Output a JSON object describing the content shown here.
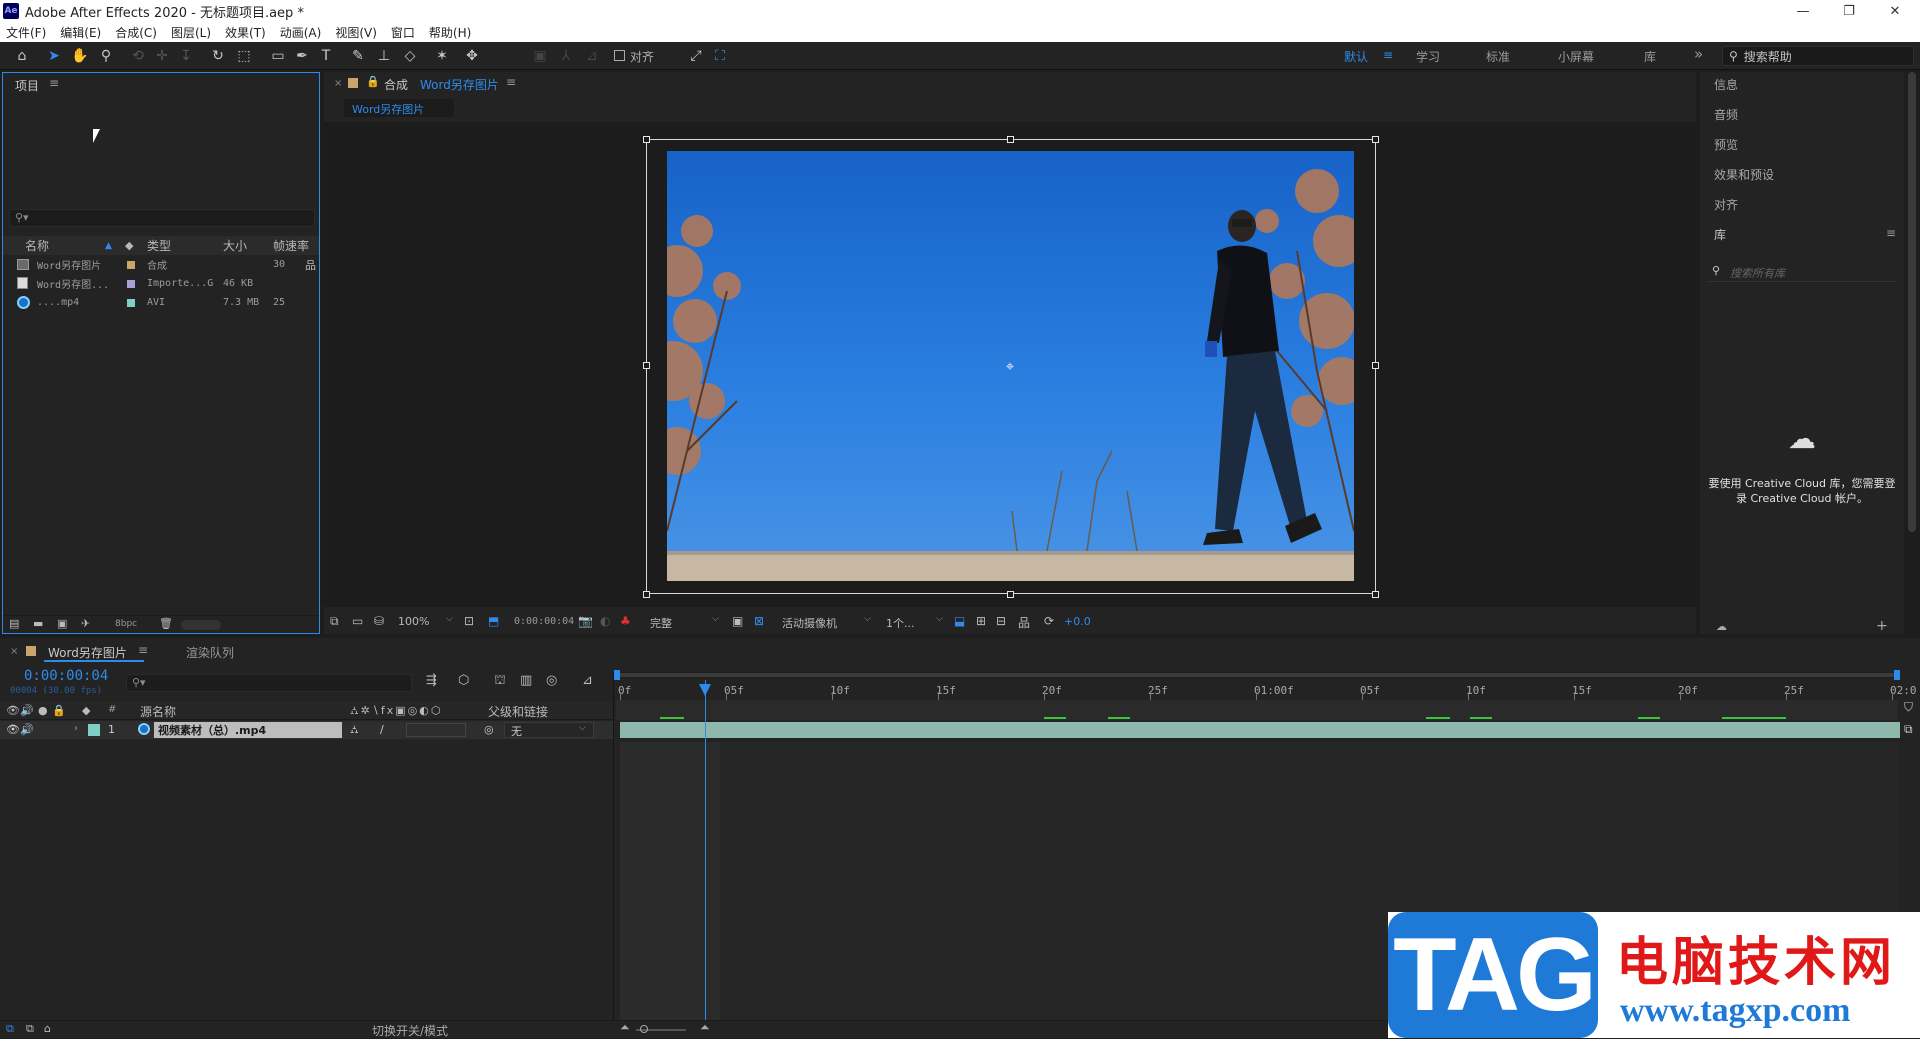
{
  "window": {
    "app_icon": "Ae",
    "title": "Adobe After Effects 2020 - 无标题项目.aep *",
    "controls": {
      "minimize": "—",
      "restore": "❐",
      "close": "✕"
    }
  },
  "menu": [
    "文件(F)",
    "编辑(E)",
    "合成(C)",
    "图层(L)",
    "效果(T)",
    "动画(A)",
    "视图(V)",
    "窗口",
    "帮助(H)"
  ],
  "toolbar": {
    "snap_label": "对齐",
    "workspaces": [
      "默认",
      "学习",
      "标准",
      "小屏幕",
      "库"
    ],
    "active_workspace": "默认",
    "more": "»",
    "help_search_placeholder": "搜索帮助"
  },
  "project": {
    "title": "项目",
    "columns": {
      "name": "名称",
      "type": "类型",
      "size": "大小",
      "fps": "帧速率"
    },
    "items": [
      {
        "name": "Word另存图片",
        "type": "合成",
        "size": "",
        "fps": "30",
        "color": "#c9a46b"
      },
      {
        "name": "Word另存图...",
        "type": "Importe...G",
        "size": "46 KB",
        "fps": "",
        "color": "#a9a0d8"
      },
      {
        "name": "....mp4",
        "type": "AVI",
        "size": "7.3 MB",
        "fps": "25",
        "color": "#7ecfc4"
      }
    ],
    "bpc": "8bpc"
  },
  "composition": {
    "panel_label": "合成",
    "comp_name": "Word另存图片",
    "tab": "Word另存图片",
    "zoom": "100%",
    "timecode": "0:00:00:04",
    "resolution": "完整",
    "camera": "活动摄像机",
    "views": "1个...",
    "exposure": "+0.0"
  },
  "right_panel": {
    "items": [
      "信息",
      "音频",
      "预览",
      "效果和预设",
      "对齐",
      "库"
    ],
    "library_search_placeholder": "搜索所有库",
    "cc_message_line1": "要使用 Creative Cloud 库，您需要登",
    "cc_message_line2": "录 Creative Cloud 帐户。"
  },
  "timeline": {
    "tab": "Word另存图片",
    "render_queue": "渲染队列",
    "timecode": "0:00:00:04",
    "frame_info": "00004 (30.00 fps)",
    "columns": {
      "source_name": "源名称",
      "parent": "父级和链接"
    },
    "layer": {
      "index": "1",
      "name": "视频素材（总）.mp4",
      "parent": "无"
    },
    "ruler_labels": [
      "0f",
      "05f",
      "10f",
      "15f",
      "20f",
      "25f",
      "01:00f",
      "05f",
      "10f",
      "15f",
      "20f",
      "25f",
      "02:0"
    ],
    "playhead_frame": 4,
    "bottom_toggle": "切换开关/模式"
  },
  "watermark": {
    "tag": "TAG",
    "site_name": "电脑技术网",
    "url": "www.tagxp.com"
  },
  "colors": {
    "accent": "#2d8ceb",
    "panel": "#232323",
    "background": "#1d1d1d",
    "watermark_red": "#e01818",
    "watermark_blue": "#1e7ad6"
  }
}
